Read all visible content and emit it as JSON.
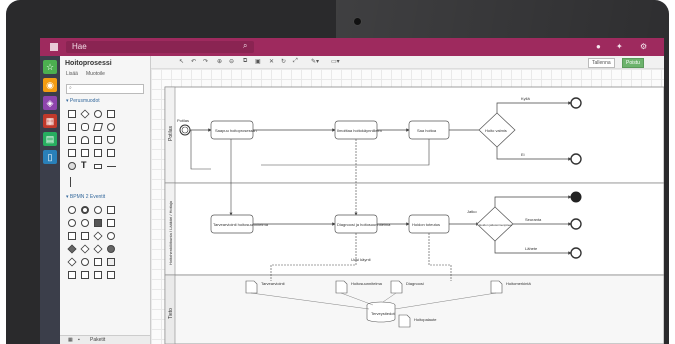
{
  "topbar": {
    "search_placeholder": "Hae"
  },
  "palette": {
    "title": "Hoitoprosessi",
    "tabs": [
      "Lisää",
      "Muotoile"
    ],
    "search_icon": "search-icon",
    "section_general": "▾ Perusmuodot",
    "section_bpmn": "▾ BPMN 2 Eventit",
    "footer_label": "Paketit"
  },
  "toolbar": {
    "save_label": "Tallenna",
    "exit_label": "Poistu"
  },
  "diagram": {
    "lanes": [
      "Potilas",
      "Hoitohenkilökunta / Lääkäri / Hoitaja",
      "Tieto"
    ],
    "lane1_tasks": [
      "Saapuu hoitoprosessiin",
      "Ilmoittaa hoitokäynnilleen",
      "Saa hoitoa"
    ],
    "lane2_tasks": [
      "Tarvearviointi hoitosuunnitelma",
      "Diagnoosi ja hoitosuunnitelma",
      "Hoidon toteutus"
    ],
    "gateways": [
      "Hoito valmis",
      "Hoidon jatkotoimenpiteet"
    ],
    "tieto_items": [
      "Tarvearviointi",
      "Hoitosuunnitelma",
      "Diagnoosi",
      "Hoitomerkintä",
      "Hoitopalaute"
    ],
    "data_store": "Terveystiedot",
    "labels": {
      "potilas_start": "Potilas",
      "kylla": "Kyllä",
      "ei": "Ei",
      "jatko": "Jatko",
      "seuranta": "Seuranta",
      "lahete": "Lähete",
      "uusi_kaynti": "Uusi käynti"
    }
  },
  "colors": {
    "topbar": "#9e2a5e",
    "rail_star": "#4caf50",
    "rail_cube": "#f39c12",
    "rail_box": "#8e44ad",
    "rail_cal": "#c0392b",
    "rail_grid": "#27ae60",
    "rail_doc": "#2980b9"
  }
}
